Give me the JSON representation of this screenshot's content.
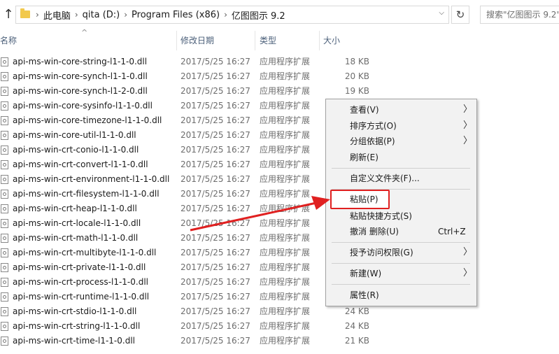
{
  "address_bar": {
    "crumbs": [
      "此电脑",
      "qita (D:)",
      "Program Files (x86)",
      "亿图图示 9.2"
    ],
    "search_placeholder": "搜索\"亿图图示 9.2\""
  },
  "columns": {
    "name": "名称",
    "date": "修改日期",
    "type": "类型",
    "size": "大小"
  },
  "files": [
    {
      "name": "api-ms-win-core-string-l1-1-0.dll",
      "date": "2017/5/25 16:27",
      "type": "应用程序扩展",
      "size": "18 KB"
    },
    {
      "name": "api-ms-win-core-synch-l1-1-0.dll",
      "date": "2017/5/25 16:27",
      "type": "应用程序扩展",
      "size": "20 KB"
    },
    {
      "name": "api-ms-win-core-synch-l1-2-0.dll",
      "date": "2017/5/25 16:27",
      "type": "应用程序扩展",
      "size": "19 KB"
    },
    {
      "name": "api-ms-win-core-sysinfo-l1-1-0.dll",
      "date": "2017/5/25 16:27",
      "type": "应用程序扩展",
      "size": ""
    },
    {
      "name": "api-ms-win-core-timezone-l1-1-0.dll",
      "date": "2017/5/25 16:27",
      "type": "应用程序扩展",
      "size": ""
    },
    {
      "name": "api-ms-win-core-util-l1-1-0.dll",
      "date": "2017/5/25 16:27",
      "type": "应用程序扩展",
      "size": ""
    },
    {
      "name": "api-ms-win-crt-conio-l1-1-0.dll",
      "date": "2017/5/25 16:27",
      "type": "应用程序扩展",
      "size": ""
    },
    {
      "name": "api-ms-win-crt-convert-l1-1-0.dll",
      "date": "2017/5/25 16:27",
      "type": "应用程序扩展",
      "size": ""
    },
    {
      "name": "api-ms-win-crt-environment-l1-1-0.dll",
      "date": "2017/5/25 16:27",
      "type": "应用程序扩展",
      "size": ""
    },
    {
      "name": "api-ms-win-crt-filesystem-l1-1-0.dll",
      "date": "2017/5/25 16:27",
      "type": "应用程序扩展",
      "size": ""
    },
    {
      "name": "api-ms-win-crt-heap-l1-1-0.dll",
      "date": "2017/5/25 16:27",
      "type": "应用程序扩展",
      "size": ""
    },
    {
      "name": "api-ms-win-crt-locale-l1-1-0.dll",
      "date": "2017/5/25 16:27",
      "type": "应用程序扩展",
      "size": ""
    },
    {
      "name": "api-ms-win-crt-math-l1-1-0.dll",
      "date": "2017/5/25 16:27",
      "type": "应用程序扩展",
      "size": ""
    },
    {
      "name": "api-ms-win-crt-multibyte-l1-1-0.dll",
      "date": "2017/5/25 16:27",
      "type": "应用程序扩展",
      "size": ""
    },
    {
      "name": "api-ms-win-crt-private-l1-1-0.dll",
      "date": "2017/5/25 16:27",
      "type": "应用程序扩展",
      "size": ""
    },
    {
      "name": "api-ms-win-crt-process-l1-1-0.dll",
      "date": "2017/5/25 16:27",
      "type": "应用程序扩展",
      "size": ""
    },
    {
      "name": "api-ms-win-crt-runtime-l1-1-0.dll",
      "date": "2017/5/25 16:27",
      "type": "应用程序扩展",
      "size": ""
    },
    {
      "name": "api-ms-win-crt-stdio-l1-1-0.dll",
      "date": "2017/5/25 16:27",
      "type": "应用程序扩展",
      "size": "24 KB"
    },
    {
      "name": "api-ms-win-crt-string-l1-1-0.dll",
      "date": "2017/5/25 16:27",
      "type": "应用程序扩展",
      "size": "24 KB"
    },
    {
      "name": "api-ms-win-crt-time-l1-1-0.dll",
      "date": "2017/5/25 16:27",
      "type": "应用程序扩展",
      "size": "21 KB"
    }
  ],
  "context_menu": {
    "view": "查看(V)",
    "sort": "排序方式(O)",
    "group": "分组依据(P)",
    "refresh": "刷新(E)",
    "customize": "自定义文件夹(F)...",
    "paste": "粘贴(P)",
    "paste_shortcut": "粘贴快捷方式(S)",
    "undo": "撤消 删除(U)",
    "undo_shortcut": "Ctrl+Z",
    "grant_access": "授予访问权限(G)",
    "new": "新建(W)",
    "properties": "属性(R)"
  },
  "colors": {
    "highlight_border": "#e02020",
    "arrow": "#e02020"
  }
}
